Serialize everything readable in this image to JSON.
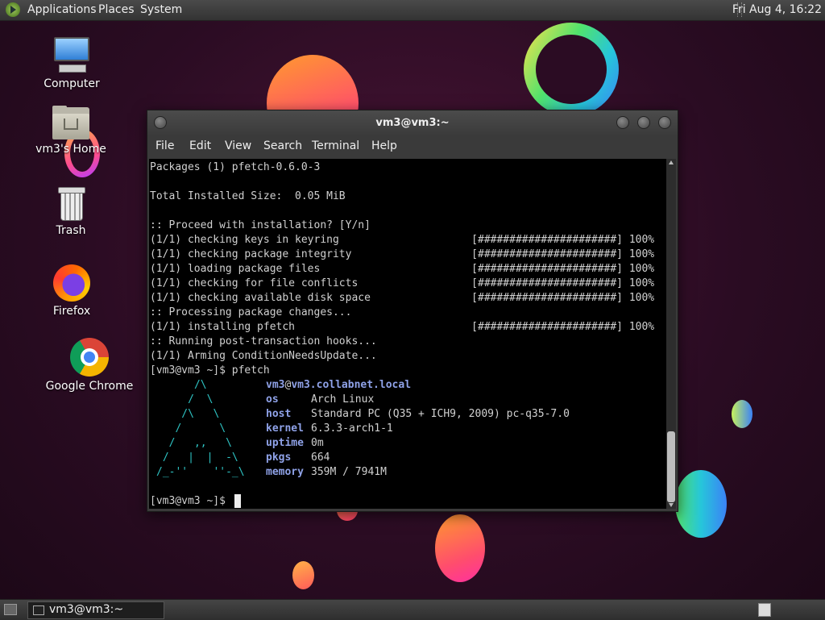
{
  "top_panel": {
    "menus": [
      "Applications",
      "Places",
      "System"
    ],
    "clock": "Fri Aug  4, 16:22"
  },
  "desktop_icons": [
    {
      "label": "Computer",
      "icon": "computer-icon"
    },
    {
      "label": "vm3's Home",
      "icon": "home-folder-icon"
    },
    {
      "label": "Trash",
      "icon": "trash-icon"
    },
    {
      "label": "Firefox",
      "icon": "firefox-icon"
    },
    {
      "label": "Google Chrome",
      "icon": "chrome-icon"
    }
  ],
  "window": {
    "title": "vm3@vm3:~",
    "menu": [
      "File",
      "Edit",
      "View",
      "Search",
      "Terminal",
      "Help"
    ]
  },
  "terminal": {
    "lines": [
      "Packages (1) pfetch-0.6.0-3",
      "",
      "Total Installed Size:  0.05 MiB",
      "",
      ":: Proceed with installation? [Y/n]",
      "(1/1) checking keys in keyring                     [######################] 100%",
      "(1/1) checking package integrity                   [######################] 100%",
      "(1/1) loading package files                        [######################] 100%",
      "(1/1) checking for file conflicts                  [######################] 100%",
      "(1/1) checking available disk space                [######################] 100%",
      ":: Processing package changes...",
      "(1/1) installing pfetch                            [######################] 100%",
      ":: Running post-transaction hooks...",
      "(1/1) Arming ConditionNeedsUpdate...",
      "[vm3@vm3 ~]$ pfetch"
    ],
    "ascii_logo": "      /\\\n     /  \\\n    /\\   \\\n   /      \\\n  /   ,,   \\\n /   |  |  -\\\n/_-''    ''-_\\",
    "pfetch": {
      "user": "vm3",
      "at": "@",
      "host": "vm3.collabnet.local",
      "rows": [
        {
          "key": "os",
          "value": "Arch Linux"
        },
        {
          "key": "host",
          "value": "Standard PC (Q35 + ICH9, 2009) pc-q35-7.0"
        },
        {
          "key": "kernel",
          "value": "6.3.3-arch1-1"
        },
        {
          "key": "uptime",
          "value": "0m"
        },
        {
          "key": "pkgs",
          "value": "664"
        },
        {
          "key": "memory",
          "value": "359M / 7941M"
        }
      ]
    },
    "prompt": "[vm3@vm3 ~]$ "
  },
  "bottom_panel": {
    "task_label": "vm3@vm3:~"
  }
}
